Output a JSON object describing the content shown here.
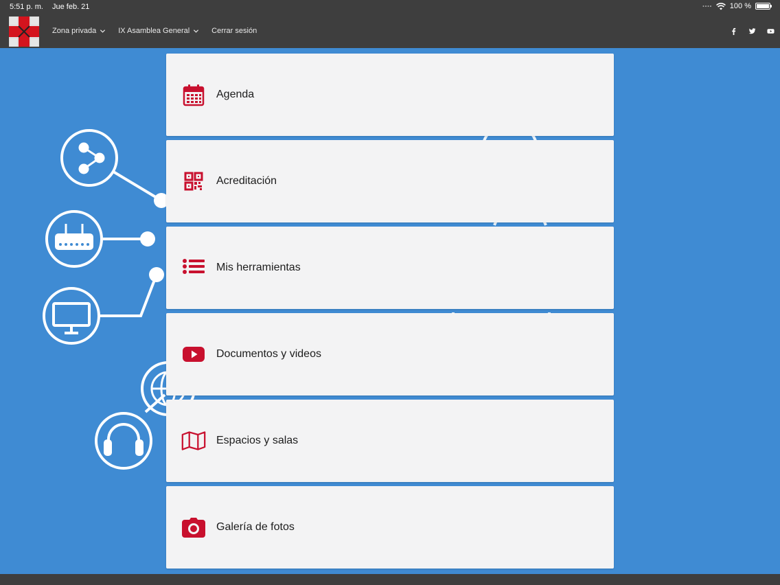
{
  "statusbar": {
    "time": "5:51 p. m.",
    "date": "Jue feb. 21",
    "battery": "100 %"
  },
  "navbar": {
    "items": [
      {
        "label": "Zona privada",
        "dropdown": true
      },
      {
        "label": "IX Asamblea General",
        "dropdown": true
      },
      {
        "label": "Cerrar sesión",
        "dropdown": false
      }
    ],
    "social": [
      "facebook-icon",
      "twitter-icon",
      "youtube-icon"
    ]
  },
  "menu": {
    "items": [
      {
        "label": "Agenda",
        "icon": "calendar-icon"
      },
      {
        "label": "Acreditación",
        "icon": "qr-code-icon"
      },
      {
        "label": "Mis herramientas",
        "icon": "list-icon"
      },
      {
        "label": "Documentos y videos",
        "icon": "youtube-play-icon"
      },
      {
        "label": "Espacios y salas",
        "icon": "map-icon"
      },
      {
        "label": "Galería de fotos",
        "icon": "camera-icon"
      }
    ]
  },
  "colors": {
    "accent": "#c8102e",
    "background": "#3f8bd3",
    "bar": "#3e3e3e",
    "card": "#f3f3f4"
  }
}
